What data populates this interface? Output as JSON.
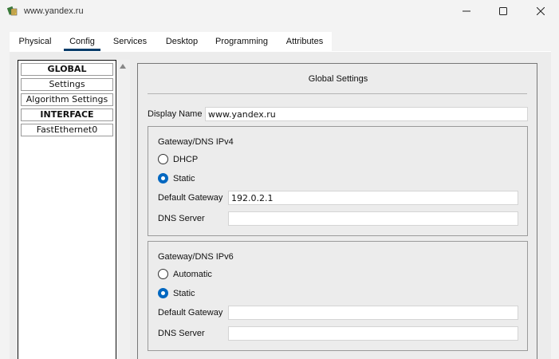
{
  "window": {
    "title": "www.yandex.ru",
    "controls": {
      "minimize": "—",
      "maximize": "☐",
      "close": "✕"
    }
  },
  "tabs": [
    {
      "label": "Physical"
    },
    {
      "label": "Config",
      "active": true
    },
    {
      "label": "Services"
    },
    {
      "label": "Desktop"
    },
    {
      "label": "Programming"
    },
    {
      "label": "Attributes"
    }
  ],
  "sidebar": {
    "items": [
      {
        "label": "GLOBAL",
        "header": true
      },
      {
        "label": "Settings"
      },
      {
        "label": "Algorithm Settings"
      },
      {
        "label": "INTERFACE",
        "header": true
      },
      {
        "label": "FastEthernet0"
      }
    ]
  },
  "global_settings": {
    "title": "Global Settings",
    "display_name_label": "Display Name",
    "display_name_value": "www.yandex.ru",
    "ipv4": {
      "title": "Gateway/DNS IPv4",
      "dhcp_label": "DHCP",
      "static_label": "Static",
      "selected": "Static",
      "gateway_label": "Default Gateway",
      "gateway_value": "192.0.2.1",
      "dns_label": "DNS Server",
      "dns_value": ""
    },
    "ipv6": {
      "title": "Gateway/DNS IPv6",
      "automatic_label": "Automatic",
      "static_label": "Static",
      "selected": "Static",
      "gateway_label": "Default Gateway",
      "gateway_value": "",
      "dns_label": "DNS Server",
      "dns_value": ""
    }
  }
}
